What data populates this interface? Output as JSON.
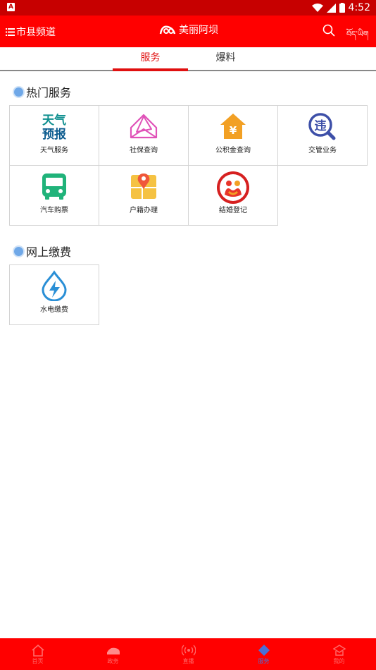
{
  "status_bar": {
    "time": "4:52"
  },
  "app_bar": {
    "menu_label": "市县频道",
    "logo_text": "美丽阿坝",
    "lang_label": "བོད་ཡིག"
  },
  "tabs": [
    {
      "label": "服务",
      "active": true
    },
    {
      "label": "爆料",
      "active": false
    }
  ],
  "sections": {
    "hot": {
      "title": "热门服务"
    },
    "pay": {
      "title": "网上缴费"
    }
  },
  "hot_services": [
    {
      "label": "天气服务",
      "icon": "weather-forecast-icon",
      "icon_text": [
        "天气",
        "预报"
      ]
    },
    {
      "label": "社保查询",
      "icon": "envelope-icon"
    },
    {
      "label": "公积金查询",
      "icon": "house-yuan-icon",
      "icon_text": [
        "¥"
      ]
    },
    {
      "label": "交管业务",
      "icon": "traffic-violation-icon",
      "icon_text": [
        "违"
      ]
    },
    {
      "label": "汽车购票",
      "icon": "bus-icon"
    },
    {
      "label": "户籍办理",
      "icon": "map-pin-icon"
    },
    {
      "label": "结婚登记",
      "icon": "marriage-seal-icon"
    }
  ],
  "pay_services": [
    {
      "label": "水电缴费",
      "icon": "water-electric-icon"
    }
  ],
  "bottom_nav": [
    {
      "label": "首页",
      "icon": "home-icon"
    },
    {
      "label": "政务",
      "icon": "government-icon"
    },
    {
      "label": "直播",
      "icon": "live-broadcast-icon"
    },
    {
      "label": "服务",
      "icon": "service-icon",
      "active": true
    },
    {
      "label": "我的",
      "icon": "profile-icon"
    }
  ],
  "colors": {
    "header_red": "#ff0000",
    "status_red": "#c70000",
    "tab_active": "#e01010",
    "nav_active": "#4a6fd8"
  }
}
